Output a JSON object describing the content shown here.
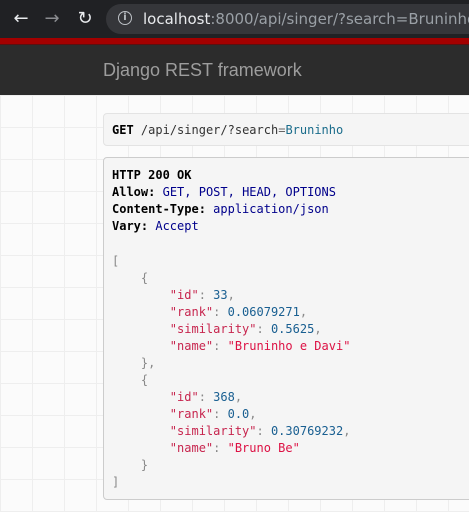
{
  "browser": {
    "url_host": "localhost",
    "url_rest": ":8000/api/singer/?search=Bruninho"
  },
  "navbar": {
    "brand": "Django REST framework"
  },
  "request": {
    "method": "GET",
    "path": "/api/singer/?",
    "query_key": "search",
    "query_eq": "=",
    "query_value": "Bruninho"
  },
  "response": {
    "status": "HTTP 200 OK",
    "headers": [
      {
        "key": "Allow:",
        "value": "GET, POST, HEAD, OPTIONS"
      },
      {
        "key": "Content-Type:",
        "value": "application/json"
      },
      {
        "key": "Vary:",
        "value": "Accept"
      }
    ],
    "body": {
      "open": "[",
      "close": "]",
      "items": [
        {
          "open": "{",
          "close": "},",
          "fields": [
            {
              "key": "\"id\"",
              "value": "33",
              "sep": ",",
              "kind": "num"
            },
            {
              "key": "\"rank\"",
              "value": "0.06079271",
              "sep": ",",
              "kind": "num"
            },
            {
              "key": "\"similarity\"",
              "value": "0.5625",
              "sep": ",",
              "kind": "num"
            },
            {
              "key": "\"name\"",
              "value": "\"Bruninho e Davi\"",
              "sep": "",
              "kind": "str"
            }
          ]
        },
        {
          "open": "{",
          "close": "}",
          "fields": [
            {
              "key": "\"id\"",
              "value": "368",
              "sep": ",",
              "kind": "num"
            },
            {
              "key": "\"rank\"",
              "value": "0.0",
              "sep": ",",
              "kind": "num"
            },
            {
              "key": "\"similarity\"",
              "value": "0.30769232",
              "sep": ",",
              "kind": "num"
            },
            {
              "key": "\"name\"",
              "value": "\"Bruno Be\"",
              "sep": "",
              "kind": "str"
            }
          ]
        }
      ]
    }
  }
}
